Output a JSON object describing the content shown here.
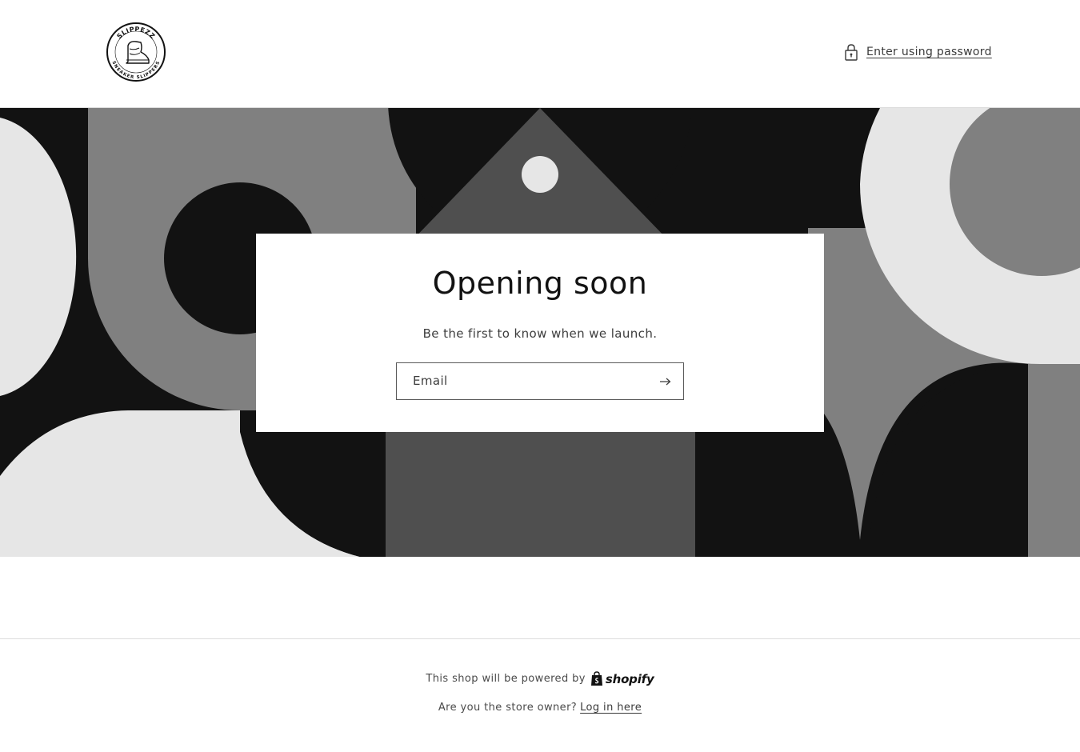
{
  "header": {
    "logo_text_top": "SLIPPEZZ",
    "logo_text_bottom": "SNEAKER SLIPPERS",
    "password_link": "Enter using password",
    "password_icon": "lock-icon"
  },
  "banner": {
    "colors": {
      "black": "#121212",
      "dark": "#4f4f4f",
      "mid": "#808080",
      "light": "#e6e6e6"
    }
  },
  "newsletter": {
    "title": "Opening soon",
    "subtitle": "Be the first to know when we launch.",
    "email_label": "Email",
    "submit_icon": "arrow-right-icon"
  },
  "footer": {
    "powered_by": "This shop will be powered by",
    "shopify": "shopify",
    "owner_question": "Are you the store owner?",
    "login_link": "Log in here"
  }
}
